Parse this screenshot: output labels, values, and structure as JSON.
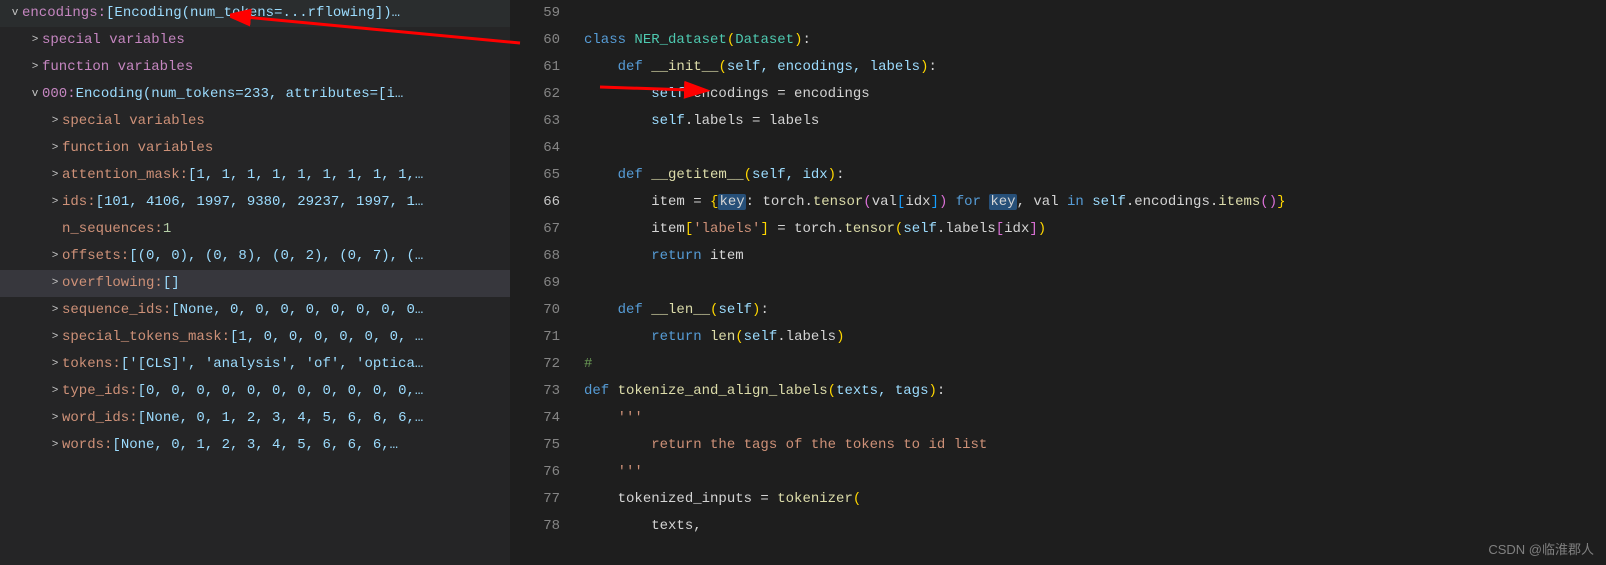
{
  "sidebar": {
    "top": {
      "label": "encodings: ",
      "value": "[Encoding(num_tokens=...rflowing])…"
    },
    "group1": [
      {
        "chev": ">",
        "label": "special variables",
        "value": ""
      },
      {
        "chev": ">",
        "label": "function variables",
        "value": ""
      }
    ],
    "entry": {
      "chev": "v",
      "label": "000: ",
      "value": "Encoding(num_tokens=233, attributes=[i…"
    },
    "group2": [
      {
        "chev": ">",
        "pad": "indent2",
        "label": "special variables",
        "value": ""
      },
      {
        "chev": ">",
        "pad": "indent2",
        "label": "function variables",
        "value": ""
      },
      {
        "chev": ">",
        "pad": "indent2",
        "label": "attention_mask: ",
        "value": "[1, 1, 1, 1, 1, 1, 1, 1, 1,…"
      },
      {
        "chev": ">",
        "pad": "indent2",
        "label": "ids: ",
        "value": "[101, 4106, 1997, 9380, 29237, 1997, 1…"
      },
      {
        "chev": "",
        "pad": "indent2",
        "label": "n_sequences: ",
        "value": "1"
      },
      {
        "chev": ">",
        "pad": "indent2",
        "label": "offsets: ",
        "value": "[(0, 0), (0, 8), (0, 2), (0, 7), (…"
      },
      {
        "chev": ">",
        "pad": "indent2",
        "label": "overflowing: ",
        "value": "[]",
        "selected": true
      },
      {
        "chev": ">",
        "pad": "indent2",
        "label": "sequence_ids: ",
        "value": "[None, 0, 0, 0, 0, 0, 0, 0, 0…"
      },
      {
        "chev": ">",
        "pad": "indent2",
        "label": "special_tokens_mask: ",
        "value": "[1, 0, 0, 0, 0, 0, 0, …"
      },
      {
        "chev": ">",
        "pad": "indent2",
        "label": "tokens: ",
        "value": "['[CLS]', 'analysis', 'of', 'optica…"
      },
      {
        "chev": ">",
        "pad": "indent2",
        "label": "type_ids: ",
        "value": "[0, 0, 0, 0, 0, 0, 0, 0, 0, 0, 0,…"
      },
      {
        "chev": ">",
        "pad": "indent2",
        "label": "word_ids: ",
        "value": "[None, 0, 1, 2, 3, 4, 5, 6, 6, 6,…"
      },
      {
        "chev": ">",
        "pad": "indent2",
        "label": "words: ",
        "value": "[None, 0, 1, 2, 3, 4, 5, 6, 6, 6,…"
      }
    ]
  },
  "editor": {
    "lines": [
      "59",
      "60",
      "61",
      "62",
      "63",
      "64",
      "65",
      "66",
      "67",
      "68",
      "69",
      "70",
      "71",
      "72",
      "73",
      "74",
      "75",
      "76",
      "77",
      "78"
    ],
    "active_line": "66"
  },
  "code": {
    "l60_class": "class ",
    "l60_name": "NER_dataset",
    "l60_base": "Dataset",
    "l61_def": "def ",
    "l61_name": "__init__",
    "l61_params": "self, encodings, labels",
    "l62_a": "self.encodings = encodings",
    "l63_a": "self.labels = labels",
    "l65_name": "__getitem__",
    "l65_params": "self, idx",
    "l66_item": "item = ",
    "l66_key1": "key",
    "l66_torch": "torch.tensor",
    "l66_val": "val",
    "l66_idx": "idx",
    "l66_for": " for ",
    "l66_key2": "key",
    "l66_valin": ", val ",
    "l66_in": "in ",
    "l66_tail": "self.encodings.items",
    "l67_a": "item",
    "l67_str": "'labels'",
    "l67_mid": " = torch.tensor",
    "l67_tail": "self.labels",
    "l67_idx": "idx",
    "l68_ret": "return ",
    "l68_item": "item",
    "l70_name": "__len__",
    "l70_params": "self",
    "l71_ret": "return ",
    "l71_len": "len",
    "l71_tail": "self.labels",
    "l72_hash": "#",
    "l73_def": "def ",
    "l73_name": "tokenize_and_align_labels",
    "l73_params": "texts, tags",
    "l74_doc": "'''",
    "l75_doc": "return the tags of the tokens to id list",
    "l76_doc": "'''",
    "l77_a": "tokenized_inputs = tokenizer",
    "l78_a": "texts,"
  },
  "watermark": "CSDN @临淮郡人"
}
